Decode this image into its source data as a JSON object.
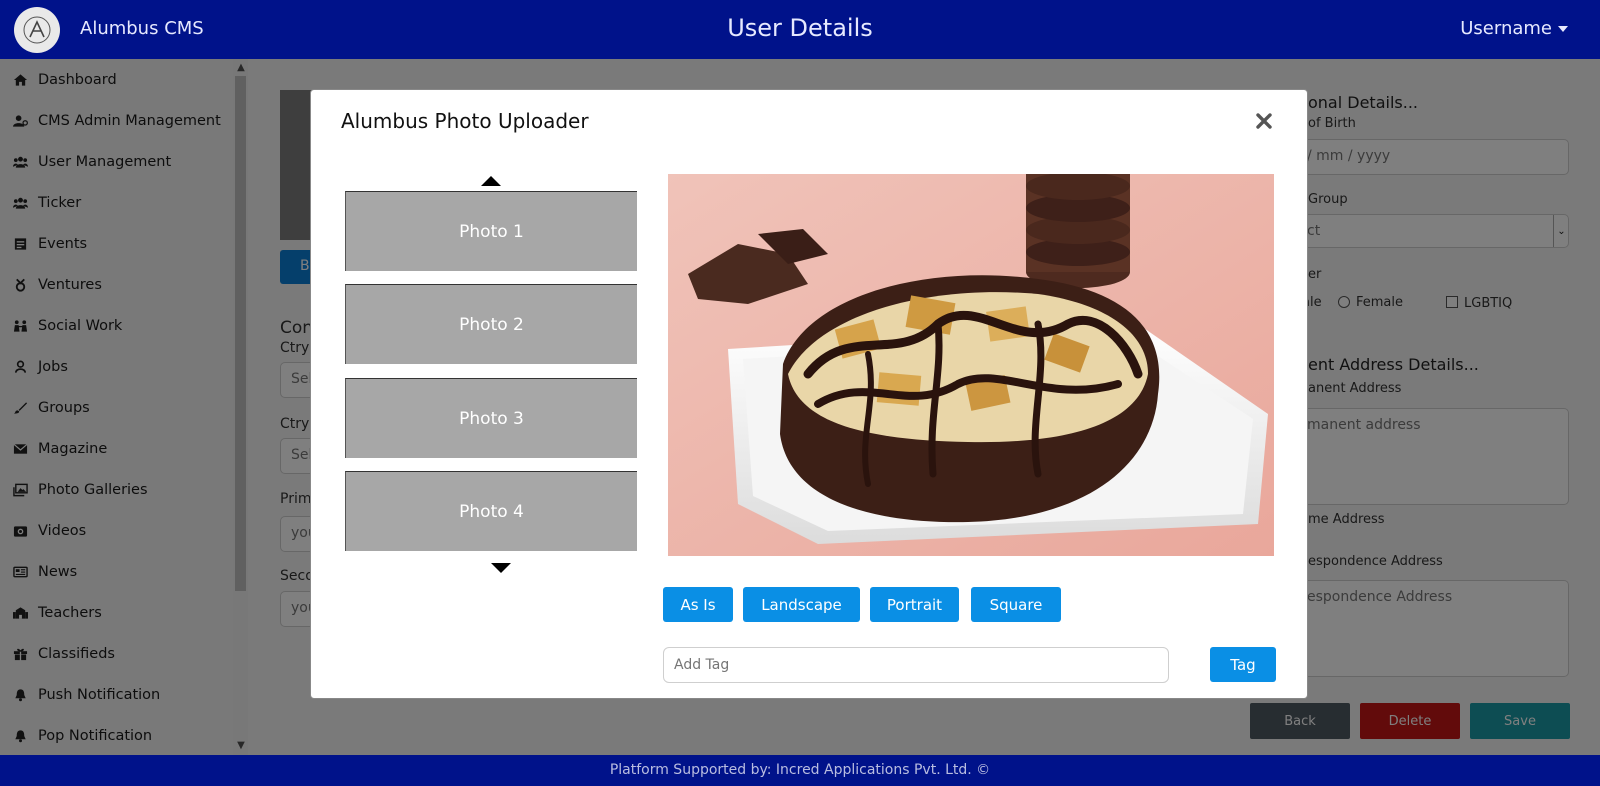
{
  "header": {
    "app_title": "Alumbus CMS",
    "page_title": "User Details",
    "username": "Username"
  },
  "sidebar": {
    "items": [
      {
        "label": "Dashboard",
        "icon": "home-icon"
      },
      {
        "label": "CMS Admin Management",
        "icon": "user-cog-icon"
      },
      {
        "label": "User Management",
        "icon": "users-icon"
      },
      {
        "label": "Ticker",
        "icon": "users-icon"
      },
      {
        "label": "Events",
        "icon": "calendar-icon"
      },
      {
        "label": "Ventures",
        "icon": "venture-icon"
      },
      {
        "label": "Social Work",
        "icon": "social-icon"
      },
      {
        "label": "Jobs",
        "icon": "person-icon"
      },
      {
        "label": "Groups",
        "icon": "brush-icon"
      },
      {
        "label": "Magazine",
        "icon": "envelope-icon"
      },
      {
        "label": "Photo Galleries",
        "icon": "images-icon"
      },
      {
        "label": "Videos",
        "icon": "camera-icon"
      },
      {
        "label": "News",
        "icon": "newspaper-icon"
      },
      {
        "label": "Teachers",
        "icon": "school-icon"
      },
      {
        "label": "Classifieds",
        "icon": "gift-icon"
      },
      {
        "label": "Push Notification",
        "icon": "bell-icon"
      },
      {
        "label": "Pop Notification",
        "icon": "bell-icon"
      }
    ]
  },
  "background": {
    "upload_btn_partial": "B",
    "contact_heading_partial": "Con",
    "ctry_label_1": "Ctry",
    "ctry_select_1": "Sel",
    "ctry_label_2": "Ctry",
    "ctry_select_2": "Sel",
    "primary_label_partial": "Prim",
    "primary_placeholder_partial": "you",
    "secondary_label_partial": "Seco",
    "secondary_placeholder_partial": "you",
    "personal_details_partial": "onal Details...",
    "dob_label_partial": "of Birth",
    "dob_placeholder_partial": "/ mm / yyyy",
    "group_label_partial": "Group",
    "group_select_partial": "ct",
    "gender_label_partial": "er",
    "gender_male_partial": "ale",
    "gender_female": "Female",
    "gender_lgbtiq": "LGBTIQ",
    "address_heading_partial": "ent Address Details...",
    "permanent_label_partial": "anent Address",
    "permanent_placeholder_partial": "manent address",
    "same_address_partial": "me Address",
    "correspondence_label_partial": "espondence Address",
    "correspondence_placeholder_partial": "espondence Address",
    "back_label": "Back",
    "delete_label": "Delete",
    "save_label": "Save"
  },
  "modal": {
    "title": "Alumbus Photo Uploader",
    "photos": [
      "Photo 1",
      "Photo 2",
      "Photo 3",
      "Photo 4"
    ],
    "aspect_buttons": [
      "As Is",
      "Landscape",
      "Portrait",
      "Square"
    ],
    "tag_placeholder": "Add Tag",
    "tag_button": "Tag"
  },
  "footer": {
    "text": "Platform Supported by: Incred Applications Pvt. Ltd. ©"
  },
  "colors": {
    "header_bg": "#00128a",
    "primary_button": "#0a8fe5",
    "back_button": "#4f5a63",
    "delete_button": "#c51616",
    "save_button": "#1a9aa6"
  }
}
